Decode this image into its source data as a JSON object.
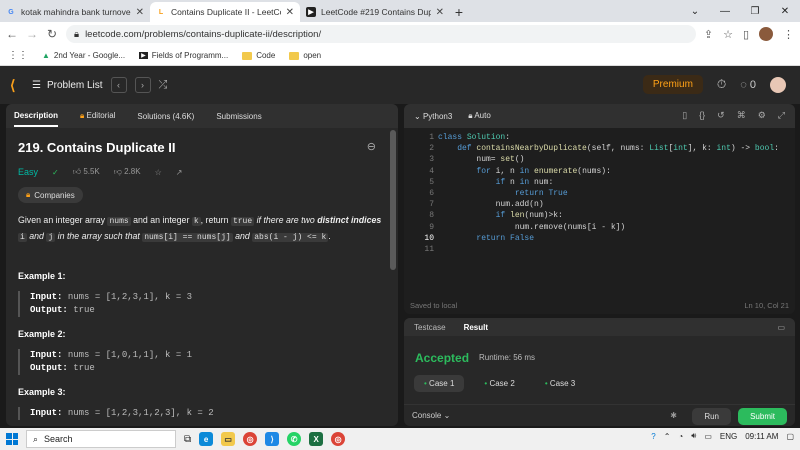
{
  "browser": {
    "tabs": [
      {
        "title": "kotak mahindra bank turnover - G",
        "favicon": "G",
        "color": "#4285f4"
      },
      {
        "title": "Contains Duplicate II - LeetCode",
        "favicon": "L",
        "color": "#f89f1b"
      },
      {
        "title": "LeetCode #219 Contains Duplicat",
        "favicon": "▶",
        "color": "#222"
      }
    ],
    "url": "leetcode.com/problems/contains-duplicate-ii/description/",
    "bookmarks": [
      "2nd Year - Google...",
      "Fields of Programm...",
      "Code",
      "open"
    ]
  },
  "lc": {
    "problem_list": "Problem List",
    "premium": "Premium",
    "coins": "0"
  },
  "left": {
    "tabs": [
      "Description",
      "Editorial",
      "Solutions (4.6K)",
      "Submissions"
    ],
    "title": "219. Contains Duplicate II",
    "difficulty": "Easy",
    "likes": "5.5K",
    "dislikes": "2.8K",
    "companies": "Companies",
    "desc": {
      "p1": "Given an integer array ",
      "c1": "nums",
      "p2": " and an integer ",
      "c2": "k",
      "p3": ", return ",
      "c3": "true",
      "p4": " if there are two ",
      "b1": "distinct indices",
      "c4": "i",
      "p5": " and ",
      "c5": "j",
      "p6": " in the array such that ",
      "c6": "nums[i] == nums[j]",
      "p7": " and ",
      "c7": "abs(i - j) <= k",
      "p8": "."
    },
    "examples": [
      {
        "h": "Example 1:",
        "input": "nums = [1,2,3,1], k = 3",
        "output": "true"
      },
      {
        "h": "Example 2:",
        "input": "nums = [1,0,1,1], k = 1",
        "output": "true"
      },
      {
        "h": "Example 3:",
        "input": "nums = [1,2,3,1,2,3], k = 2",
        "output": ""
      }
    ],
    "input_label": "Input:",
    "output_label": "Output:"
  },
  "editor": {
    "language": "Python3",
    "mode": "Auto",
    "saved": "Saved to local",
    "pos": "Ln 10, Col 21"
  },
  "result": {
    "tabs": [
      "Testcase",
      "Result"
    ],
    "status": "Accepted",
    "runtime": "Runtime: 56 ms",
    "cases": [
      "Case 1",
      "Case 2",
      "Case 3"
    ],
    "console": "Console",
    "run": "Run",
    "submit": "Submit"
  },
  "taskbar": {
    "search": "Search",
    "lang": "ENG",
    "time": "09:11 AM"
  }
}
